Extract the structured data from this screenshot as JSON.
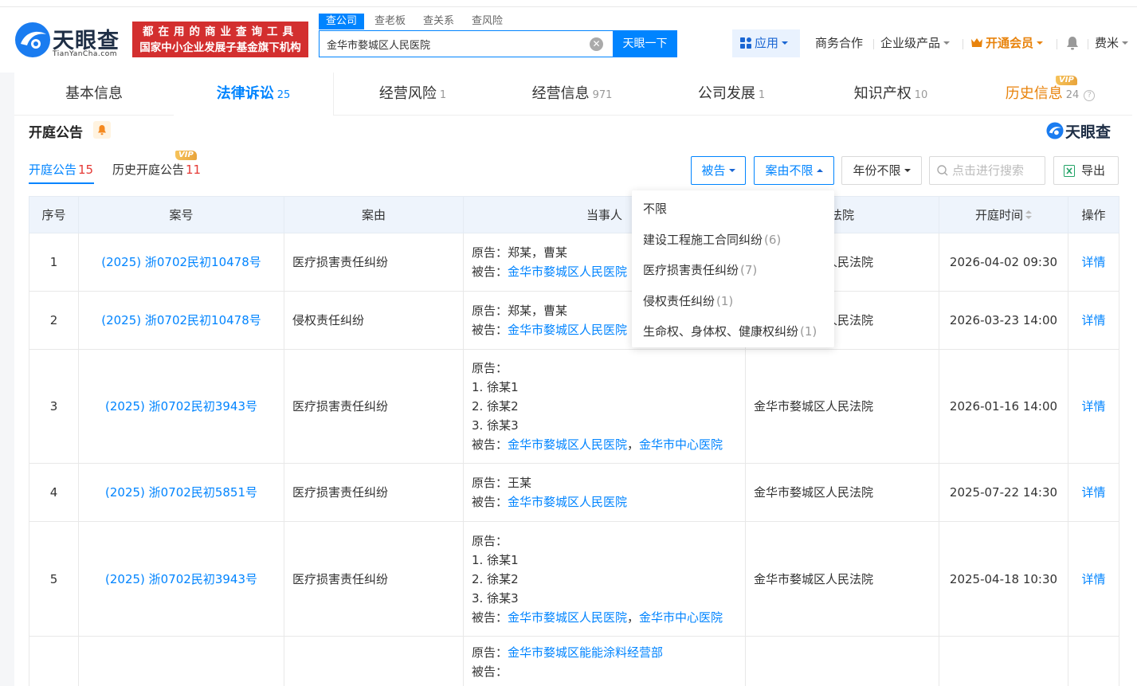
{
  "header": {
    "logo_name": "天眼查",
    "logo_domain": "TianYanCha.com",
    "slogan_line1": "都在用的商业查询工具",
    "slogan_line2": "国家中小企业发展子基金旗下机构",
    "search_tabs": [
      "查公司",
      "查老板",
      "查关系",
      "查风险"
    ],
    "search_value": "金华市婺城区人民医院",
    "search_button": "天眼一下",
    "apps_label": "应用",
    "business_label": "商务合作",
    "enterprise_label": "企业级产品",
    "vip_label": "开通会员",
    "user_label": "费米"
  },
  "section_tabs": [
    {
      "label": "基本信息",
      "count": ""
    },
    {
      "label": "法律诉讼",
      "count": "25"
    },
    {
      "label": "经营风险",
      "count": "1"
    },
    {
      "label": "经营信息",
      "count": "971"
    },
    {
      "label": "公司发展",
      "count": "1"
    },
    {
      "label": "知识产权",
      "count": "10"
    },
    {
      "label": "历史信息",
      "count": "24"
    }
  ],
  "vip_text": "VIP",
  "section": {
    "title": "开庭公告",
    "brand": "天眼查",
    "subtabs": [
      {
        "label": "开庭公告",
        "count": "15"
      },
      {
        "label": "历史开庭公告",
        "count": "11"
      }
    ],
    "filters": {
      "defendant": "被告",
      "cause": "案由不限",
      "year": "年份不限",
      "search_placeholder": "点击进行搜索",
      "export": "导出"
    }
  },
  "table": {
    "headers": [
      "序号",
      "案号",
      "案由",
      "当事人",
      "法院",
      "开庭时间",
      "操作"
    ],
    "rows": [
      {
        "no": "1",
        "case_no": "(2025) 浙0702民初10478号",
        "cause": "医疗损害责任纠纷",
        "plaintiff_label": "原告：",
        "plaintiffs": "郑某，曹某",
        "defendant_label": "被告：",
        "defendants": "金华市婺城区人民医院",
        "court": "金华市婺城区人民法院",
        "time": "2026-04-02 09:30",
        "action": "详情"
      },
      {
        "no": "2",
        "case_no": "(2025) 浙0702民初10478号",
        "cause": "侵权责任纠纷",
        "plaintiff_label": "原告：",
        "plaintiffs": "郑某，曹某",
        "defendant_label": "被告：",
        "defendants": "金华市婺城区人民医院",
        "court": "金华市婺城区人民法院",
        "time": "2026-03-23 14:00",
        "action": "详情"
      },
      {
        "no": "3",
        "case_no": "(2025) 浙0702民初3943号",
        "cause": "医疗损害责任纠纷",
        "plaintiff_label": "原告：",
        "plaintiff_list": [
          "1. 徐某1",
          "2. 徐某2",
          "3. 徐某3"
        ],
        "defendant_label": "被告：",
        "defendants": [
          "金华市婺城区人民医院",
          "金华市中心医院"
        ],
        "court": "金华市婺城区人民法院",
        "time": "2026-01-16 14:00",
        "action": "详情"
      },
      {
        "no": "4",
        "case_no": "(2025) 浙0702民初5851号",
        "cause": "医疗损害责任纠纷",
        "plaintiff_label": "原告：",
        "plaintiffs": "王某",
        "defendant_label": "被告：",
        "defendants": "金华市婺城区人民医院",
        "court": "金华市婺城区人民法院",
        "time": "2025-07-22 14:30",
        "action": "详情"
      },
      {
        "no": "5",
        "case_no": "(2025) 浙0702民初3943号",
        "cause": "医疗损害责任纠纷",
        "plaintiff_label": "原告：",
        "plaintiff_list": [
          "1. 徐某1",
          "2. 徐某2",
          "3. 徐某3"
        ],
        "defendant_label": "被告：",
        "defendants": [
          "金华市婺城区人民医院",
          "金华市中心医院"
        ],
        "court": "金华市婺城区人民法院",
        "time": "2025-04-18 10:30",
        "action": "详情"
      },
      {
        "plaintiff_label": "原告：",
        "plaintiffs": "金华市婺城区能能涂料经营部",
        "defendant_label": "被告："
      }
    ]
  },
  "dropdown": {
    "items": [
      {
        "label": "不限",
        "count": ""
      },
      {
        "label": "建设工程施工合同纠纷",
        "count": "(6)"
      },
      {
        "label": "医疗损害责任纠纷",
        "count": "(7)"
      },
      {
        "label": "侵权责任纠纷",
        "count": "(1)"
      },
      {
        "label": "生命权、身体权、健康权纠纷",
        "count": "(1)"
      }
    ]
  },
  "colors": {
    "accent": "#0084ff",
    "vip": "#e8830c",
    "danger": "#e53935"
  }
}
